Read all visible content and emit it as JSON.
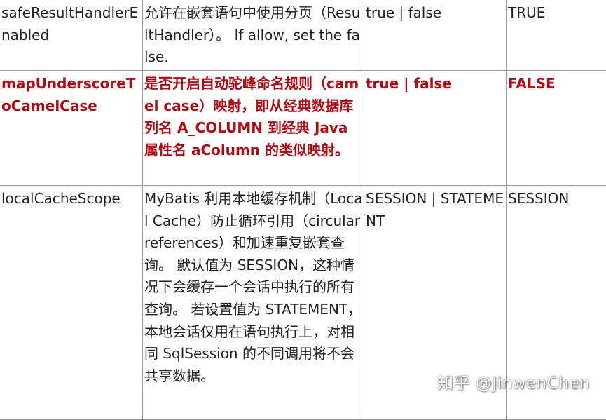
{
  "table": {
    "rows": [
      {
        "name": "safeResultHandlerEnabled",
        "description": "允许在嵌套语句中使用分页（ResultHandler）。 If allow, set the false.",
        "valid_values": "true | false",
        "default": "TRUE",
        "highlighted": false
      },
      {
        "name": "mapUnderscoreToCamelCase",
        "description": "是否开启自动驼峰命名规则（camel case）映射，即从经典数据库列名 A_COLUMN 到经典 Java 属性名 aColumn 的类似映射。",
        "valid_values": "true | false",
        "default": "FALSE",
        "highlighted": true
      },
      {
        "name": "localCacheScope",
        "description": "MyBatis 利用本地缓存机制（Local Cache）防止循环引用（circular references）和加速重复嵌套查询。 默认值为 SESSION，这种情况下会缓存一个会话中执行的所有查询。 若设置值为 STATEMENT，本地会话仅用在语句执行上，对相同 SqlSession 的不同调用将不会共享数据。",
        "valid_values": "SESSION | STATEMENT",
        "default": "SESSION",
        "highlighted": false
      }
    ]
  },
  "watermark": "知乎 @JinwenChen",
  "colors": {
    "highlight_text": "#b00a14",
    "body_text": "#222222",
    "border": "#9a9a9a"
  }
}
